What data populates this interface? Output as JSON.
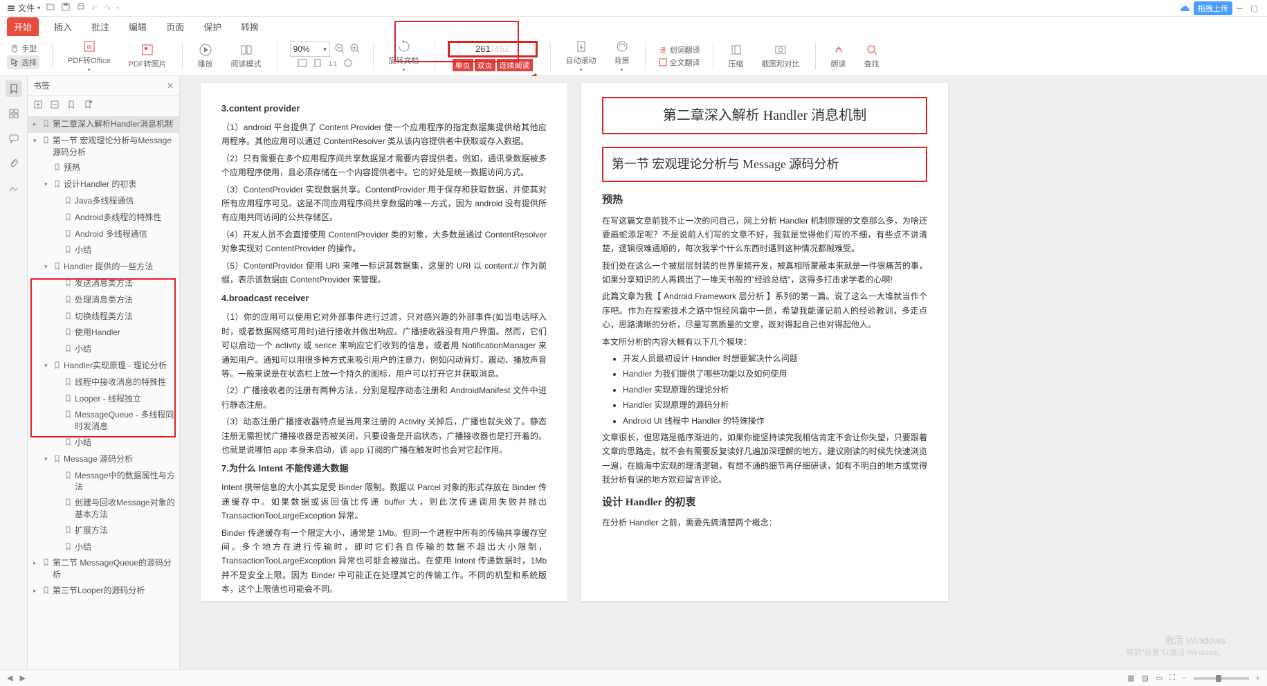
{
  "menubar": {
    "file": "文件"
  },
  "tabs": [
    "开始",
    "插入",
    "批注",
    "编辑",
    "页面",
    "保护",
    "转换"
  ],
  "toolbar": {
    "hand": "手型",
    "select": "选择",
    "pdf2office": "PDF转Office",
    "pdf2img": "PDF转图片",
    "play": "播放",
    "readmode": "阅读模式",
    "zoom_val": "90%",
    "rotate": "旋转文档",
    "page_cur": "261",
    "page_total": "/452",
    "singlepage": "单页",
    "doublepage": "双页",
    "continuous": "连续阅读",
    "autoscroll": "自动滚动",
    "background": "背景",
    "wordtrans": "划词翻译",
    "fulltrans": "全文翻译",
    "compress": "压缩",
    "screenshot": "截图和对比",
    "readaloud": "朗读",
    "find": "查找"
  },
  "topright": {
    "upload": "拖拽上传"
  },
  "bookmark": {
    "title": "书签",
    "items": [
      {
        "d": 0,
        "t": "c",
        "sel": true,
        "label": "第二章深入解析Handler消息机制"
      },
      {
        "d": 0,
        "t": "o",
        "label": "第一节 宏观理论分析与Message源码分析"
      },
      {
        "d": 1,
        "t": "l",
        "label": "预热"
      },
      {
        "d": 1,
        "t": "o",
        "label": "设计Handler 的初衷"
      },
      {
        "d": 2,
        "t": "l",
        "label": "Java多线程通信"
      },
      {
        "d": 2,
        "t": "l",
        "label": "Android多线程的特殊性"
      },
      {
        "d": 2,
        "t": "l",
        "label": "Android 多线程通信"
      },
      {
        "d": 2,
        "t": "l",
        "label": "小结"
      },
      {
        "d": 1,
        "t": "o",
        "label": "Handler 提供的一些方法"
      },
      {
        "d": 2,
        "t": "l",
        "label": "发送消息类方法"
      },
      {
        "d": 2,
        "t": "l",
        "label": "处理消息类方法"
      },
      {
        "d": 2,
        "t": "l",
        "label": "切换线程类方法"
      },
      {
        "d": 2,
        "t": "l",
        "label": "使用Handler"
      },
      {
        "d": 2,
        "t": "l",
        "label": "小结"
      },
      {
        "d": 1,
        "t": "o",
        "label": "Handler实现原理 - 理论分析"
      },
      {
        "d": 2,
        "t": "l",
        "label": "线程中接收消息的特殊性"
      },
      {
        "d": 2,
        "t": "l",
        "label": "Looper - 线程独立"
      },
      {
        "d": 2,
        "t": "l",
        "label": "MessageQueue - 多线程同时发消息"
      },
      {
        "d": 2,
        "t": "l",
        "label": "小结"
      },
      {
        "d": 1,
        "t": "o",
        "label": "Message 源码分析"
      },
      {
        "d": 2,
        "t": "l",
        "label": "Message中的数据属性与方法"
      },
      {
        "d": 2,
        "t": "l",
        "label": "创建与回收Message对象的基本方法"
      },
      {
        "d": 2,
        "t": "l",
        "label": "扩展方法"
      },
      {
        "d": 2,
        "t": "l",
        "label": "小结"
      },
      {
        "d": 0,
        "t": "c",
        "label": "第二节 MessageQueue的源码分析"
      },
      {
        "d": 0,
        "t": "c",
        "label": "第三节Looper的源码分析"
      }
    ]
  },
  "left_page": {
    "h3a": "3.content provider",
    "p1": "（1）android 平台提供了 Content Provider 使一个应用程序的指定数据集提供给其他应用程序。其他应用可以通过 ContentResolver 类从该内容提供者中获取或存入数据。",
    "p2": "（2）只有需要在多个应用程序间共享数据是才需要内容提供者。例如，通讯录数据被多个应用程序使用，且必须存储在一个内容提供者中。它的好处是统一数据访问方式。",
    "p3": "（3）ContentProvider 实现数据共享。ContentProvider 用于保存和获取数据，并使其对所有应用程序可见。这是不同应用程序间共享数据的唯一方式，因为 android 没有提供所有应用共同访问的公共存储区。",
    "p4": "（4）开发人员不会直接使用 ContentProvider 类的对象，大多数是通过 ContentResolver 对象实现对 ContentProvider 的操作。",
    "p5": "（5）ContentProvider 使用 URI 来唯一标识其数据集，这里的 URI 以 content:// 作为前缀，表示该数据由 ContentProvider 来管理。",
    "h3b": "4.broadcast receiver",
    "p6": "（1）你的应用可以使用它对外部事件进行过滤，只对感兴趣的外部事件(如当电话呼入时，或者数据网络可用时)进行接收并做出响应。广播接收器没有用户界面。然而，它们可以启动一个 activity 或 serice 来响应它们收到的信息，或者用 NotificationManager 来通知用户。通知可以用很多种方式来吸引用户的注意力，例如闪动背灯、震动、播放声音等。一般来说是在状态栏上放一个持久的图标，用户可以打开它并获取消息。",
    "p7": "（2）广播接收者的注册有两种方法，分别是程序动态注册和 AndroidManifest 文件中进行静态注册。",
    "p8": "（3）动态注册广播接收器特点是当用来注册的 Activity 关掉后，广播也就失效了。静态注册无需担忧广播接收器是否被关闭，只要设备是开启状态，广播接收器也是打开着的。也就是说哪怕 app 本身未启动，该 app 订阅的广播在触发时也会对它起作用。",
    "h3c": "7.为什么 Intent 不能传递大数据",
    "p9": "Intent 携带信息的大小其实是受 Binder 限制。数据以 Parcel 对象的形式存放在 Binder 传递缓存中。如果数据或返回值比传递 buffer 大，则此次传递调用失败并抛出 TransactionTooLargeException 异常。",
    "p10": "Binder 传递缓存有一个限定大小，通常是 1Mb。但同一个进程中所有的传输共享缓存空间。多个地方在进行传输时，即时它们各自传输的数据不超出大小限制，TransactionTooLargeException 异常也可能会被抛出。在使用 Intent 传递数据时，1Mb 并不是安全上限。因为 Binder 中可能正在处理其它的传输工作。不同的机型和系统版本，这个上限值也可能会不同。"
  },
  "right_page": {
    "chapter": "第二章深入解析 Handler 消息机制",
    "section": "第一节  宏观理论分析与 Message 源码分析",
    "sub_preheat": "预热",
    "pr1": "在写这篇文章前我不止一次的问自己，网上分析 Handler 机制原理的文章那么多，为啥还要画蛇添足呢？不是说前人们写的文章不好，我就是觉得他们写的不细，有些点不讲清楚，逻辑很难通顺的，每次我学个什么东西时遇到这种情况都贼难受。",
    "pr2": "我们处在这么一个被层层封装的世界里搞开发，被真相所蒙蔽本来就是一件很痛苦的事，如果分享知识的人再搞出了一堆天书般的\"经验总结\"，这得多打击求学者的心啊!",
    "pr3": "此篇文章为我【 Android Framework 层分析 】系列的第一篇。说了这么一大堆就当作个序吧。作为在探索技术之路中饱经风霜中一员，希望我能谨记前人的经验教训，多走点心，思路清晰的分析，尽量写高质量的文章，既对得起自己也对得起他人。",
    "pr4": "本文所分析的内容大概有以下几个模块：",
    "bullets": [
      "开发人员最初设计 Handler 时想要解决什么问题",
      "Handler 为我们提供了哪些功能以及如何使用",
      "Handler 实现原理的理论分析",
      "Handler 实现原理的源码分析",
      "Android UI 线程中 Handler 的特殊操作"
    ],
    "pr5": "文章很长，但思路是循序渐进的，如果你能坚持读完我相信肯定不会让你失望，只要跟着文章的思路走，就不会有需要反复读好几遍加深理解的地方。建议刚读的时候先快速浏览一遍，在脑海中宏观的理清逻辑，有想不通的细节再仔细研读，如有不明白的地方或觉得我分析有误的地方欢迎留言评论。",
    "sub_design": "设计 Handler 的初衷",
    "pr6": "在分析 Handler 之前，需要先搞清楚两个概念："
  },
  "watermark": {
    "l1": "激活 Windows",
    "l2": "转到\"设置\"以激活 Windows。"
  }
}
